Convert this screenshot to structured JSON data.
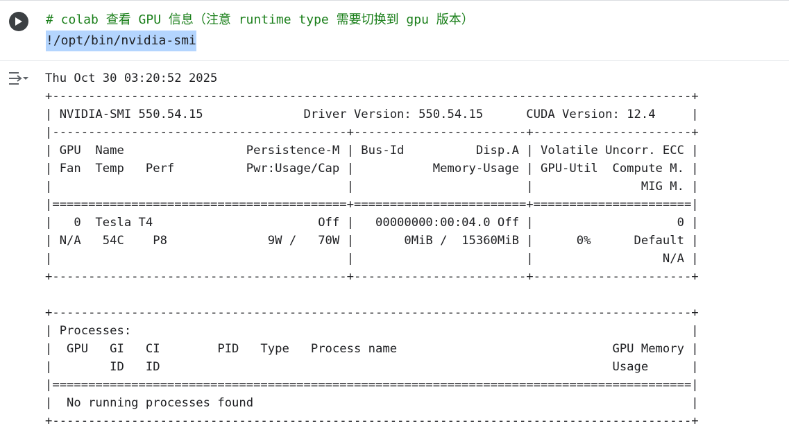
{
  "cell": {
    "run_button_icon": "play-icon",
    "code_comment": "# colab 查看 GPU 信息（注意 runtime type 需要切换到 gpu 版本）",
    "code_command": "!/opt/bin/nvidia-smi"
  },
  "output": {
    "toggle_icon": "output-collapse-icon",
    "text": "Thu Oct 30 03:20:52 2025       \n+-----------------------------------------------------------------------------------------+\n| NVIDIA-SMI 550.54.15              Driver Version: 550.54.15      CUDA Version: 12.4     |\n|-----------------------------------------+------------------------+----------------------+\n| GPU  Name                 Persistence-M | Bus-Id          Disp.A | Volatile Uncorr. ECC |\n| Fan  Temp   Perf          Pwr:Usage/Cap |           Memory-Usage | GPU-Util  Compute M. |\n|                                         |                        |               MIG M. |\n|=========================================+========================+======================|\n|   0  Tesla T4                       Off |   00000000:00:04.0 Off |                    0 |\n| N/A   54C    P8              9W /   70W |       0MiB /  15360MiB |      0%      Default |\n|                                         |                        |                  N/A |\n+-----------------------------------------+------------------------+----------------------+\n                                                                                         \n+-----------------------------------------------------------------------------------------+\n| Processes:                                                                              |\n|  GPU   GI   CI        PID   Type   Process name                              GPU Memory |\n|        ID   ID                                                               Usage      |\n|=========================================================================================|\n|  No running processes found                                                             |\n+-----------------------------------------------------------------------------------------+"
  }
}
